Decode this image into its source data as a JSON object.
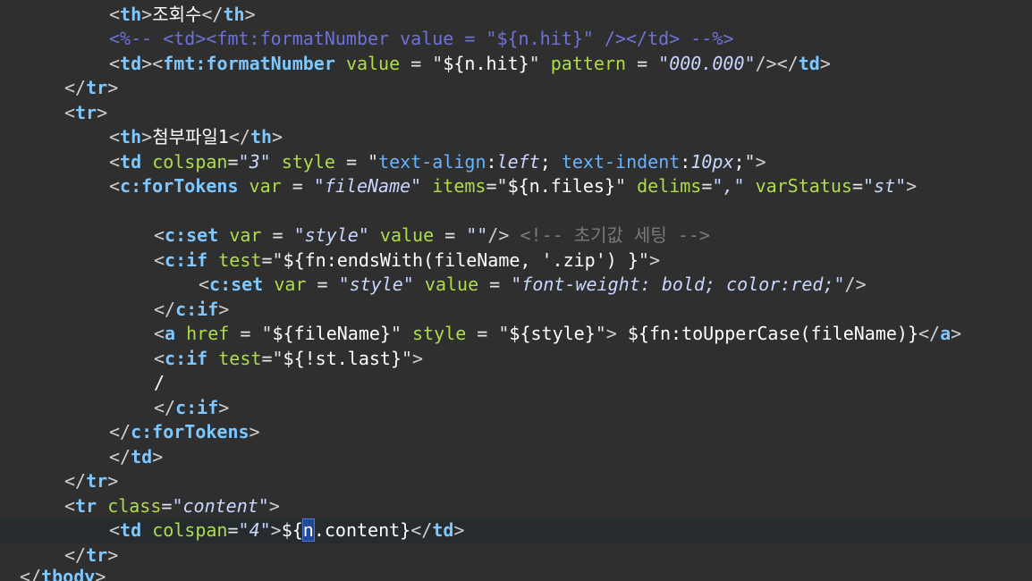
{
  "editor": {
    "line01": {
      "open": "<",
      "tag": "th",
      "close": ">",
      "text": "조회수",
      "eopen": "</",
      "etag": "th",
      "eclose": ">"
    },
    "line02": {
      "comment": "<%-- <td><fmt:formatNumber value = \"${n.hit}\" /></td> --%>"
    },
    "line03": {
      "open": "<",
      "tag": "td",
      "close": ">",
      "open2": "<",
      "tag2": "fmt:formatNumber",
      "attr1": "value",
      "eq1": " = ",
      "q1o": "\"",
      "val1": "${n.hit}",
      "q1c": "\"",
      "attr2": "pattern",
      "eq2": " = ",
      "q2o": "\"",
      "val2": "000.000",
      "q2c": "\"",
      "selfclose": "/>",
      "eopen": "</",
      "etag": "td",
      "eclose": ">"
    },
    "line04": {
      "eopen": "</",
      "etag": "tr",
      "eclose": ">"
    },
    "line05": {
      "open": "<",
      "tag": "tr",
      "close": ">"
    },
    "line06": {
      "open": "<",
      "tag": "th",
      "close": ">",
      "text": "첨부파일1",
      "eopen": "</",
      "etag": "th",
      "eclose": ">"
    },
    "line07": {
      "open": "<",
      "tag": "td",
      "attr1": "colspan",
      "eq1": "=",
      "val1": "\"3\"",
      "attr2": "style",
      "eq2": " = ",
      "q2o": "\"",
      "css1": "text-align",
      "css1c": ":",
      "css1v": "left",
      "css1s": "; ",
      "css2": "text-indent",
      "css2c": ":",
      "css2v": "10px",
      "css2s": ";",
      "q2c": "\"",
      "close": ">"
    },
    "line08": {
      "open": "<",
      "tag": "c:forTokens",
      "attr1": "var",
      "eq1": " = ",
      "val1": "\"fileName\"",
      "attr2": "items",
      "eq2": "=",
      "q2o": "\"",
      "val2": "${n.files}",
      "q2c": "\"",
      "attr3": "delims",
      "eq3": "=",
      "val3": "\",\"",
      "attr4": "varStatus",
      "eq4": "=",
      "val4": "\"st\"",
      "close": ">"
    },
    "line10": {
      "open": "<",
      "tag": "c:set",
      "attr1": "var",
      "eq1": " = ",
      "val1": "\"style\"",
      "attr2": "value",
      "eq2": " = ",
      "val2": "\"\"",
      "selfclose": "/>",
      "comment": "<!-- 초기값 세팅 -->"
    },
    "line11": {
      "open": "<",
      "tag": "c:if",
      "attr1": "test",
      "eq1": "=",
      "q1o": "\"",
      "val1": "${fn:endsWith(fileName, '.zip') }",
      "q1c": "\"",
      "close": ">"
    },
    "line12": {
      "open": "<",
      "tag": "c:set",
      "attr1": "var",
      "eq1": " = ",
      "val1": "\"style\"",
      "attr2": "value",
      "eq2": " = ",
      "val2": "\"font-weight: bold; color:red;\"",
      "selfclose": "/>"
    },
    "line13": {
      "eopen": "</",
      "etag": "c:if",
      "eclose": ">"
    },
    "line14": {
      "open": "<",
      "tag": "a",
      "attr1": "href",
      "eq1": " = ",
      "q1o": "\"",
      "val1": "${fileName}",
      "q1c": "\"",
      "attr2": "style",
      "eq2": " = ",
      "q2o": "\"",
      "val2": "${style}",
      "q2c": "\"",
      "close": ">",
      "text": " ${fn:toUpperCase(fileName)}",
      "eopen": "</",
      "etag": "a",
      "eclose": ">"
    },
    "line15": {
      "open": "<",
      "tag": "c:if",
      "attr1": "test",
      "eq1": "=",
      "q1o": "\"",
      "val1": "${!st.last}",
      "q1c": "\"",
      "close": ">"
    },
    "line16": {
      "text": "/"
    },
    "line17": {
      "eopen": "</",
      "etag": "c:if",
      "eclose": ">"
    },
    "line18": {
      "eopen": "</",
      "etag": "c:forTokens",
      "eclose": ">"
    },
    "line19": {
      "eopen": "</",
      "etag": "td",
      "eclose": ">"
    },
    "line20": {
      "eopen": "</",
      "etag": "tr",
      "eclose": ">"
    },
    "line21": {
      "open": "<",
      "tag": "tr",
      "attr1": "class",
      "eq1": "=",
      "val1": "\"content\"",
      "close": ">"
    },
    "line22": {
      "open": "<",
      "tag": "td",
      "attr1": "colspan",
      "eq1": "=",
      "val1": "\"4\"",
      "close": ">",
      "pre": "${",
      "cursor": "n",
      "post": ".content}",
      "eopen": "</",
      "etag": "td",
      "eclose": ">"
    },
    "line23": {
      "eopen": "</",
      "etag": "tr",
      "eclose": ">"
    },
    "line24": {
      "eopen": "</",
      "etag": "tbody",
      "eclose": ">"
    }
  },
  "colors": {
    "background": "#2f2f2f",
    "current_line": "#262b2e",
    "tag": "#7ec8ff",
    "attribute": "#aedd4a",
    "attribute_value": "#c7d7ff",
    "comment": "#7a7a7a",
    "jsp_comment": "#6d72d8",
    "selection": "#22489c"
  }
}
